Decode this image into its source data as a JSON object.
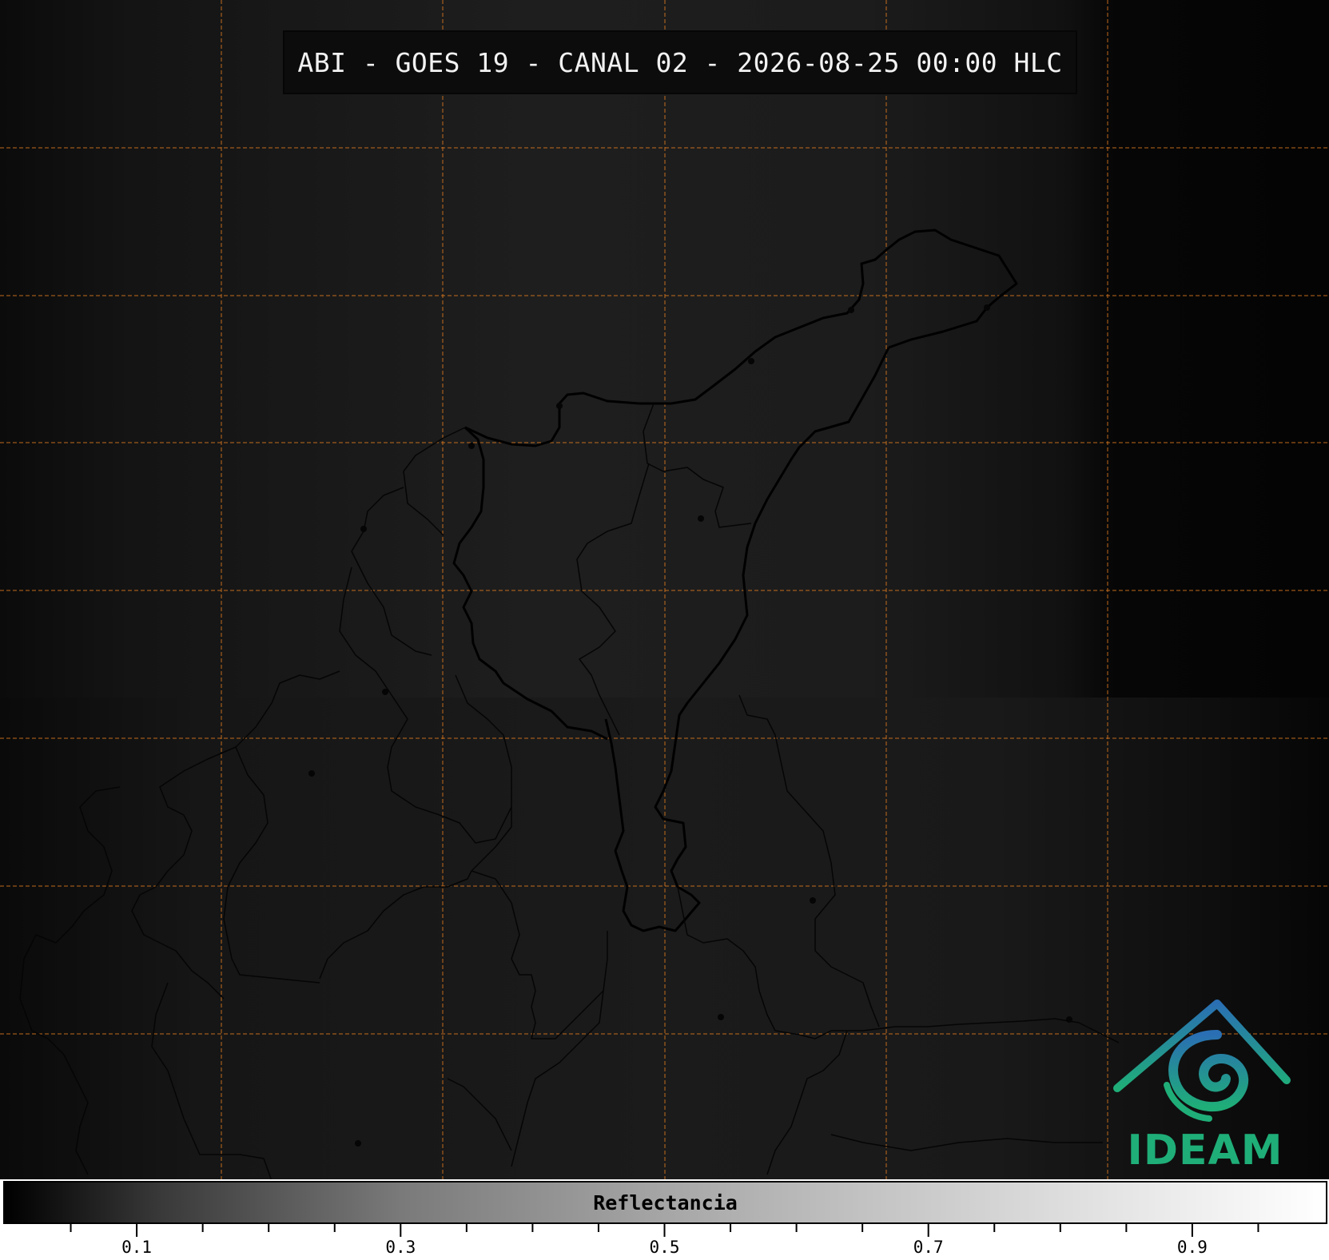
{
  "title": "ABI - GOES 19 - CANAL 02 - 2026-08-25 00:00 HLC",
  "logo": {
    "text": "IDEAM",
    "icon": "ideam-logo-icon",
    "color_primary": "#1fae78",
    "color_secondary": "#2a6fb3"
  },
  "colorbar": {
    "label": "Reflectancia",
    "min": 0.0,
    "max": 1.0,
    "tick_labels": [
      "0.1",
      "0.3",
      "0.5",
      "0.7",
      "0.9"
    ],
    "tick_values": [
      0.1,
      0.3,
      0.5,
      0.7,
      0.9
    ],
    "minor_tick_step": 0.05
  },
  "grid": {
    "color": "#e07b1f",
    "style": "dashed"
  }
}
